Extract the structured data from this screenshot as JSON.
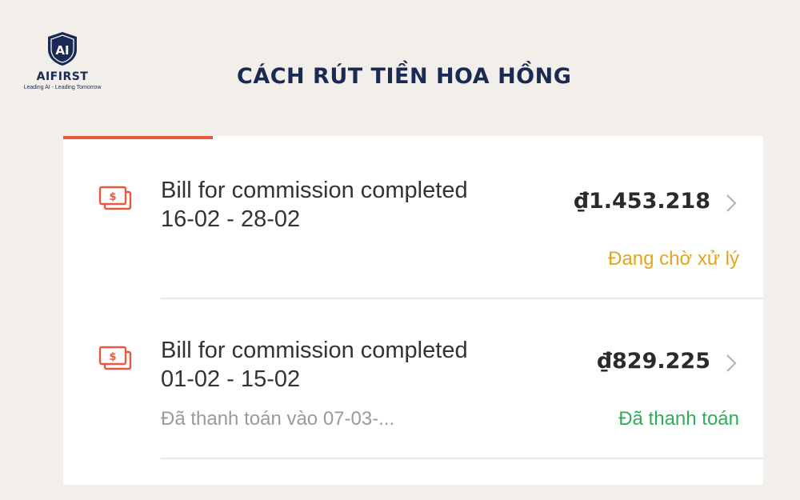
{
  "brand": {
    "name": "AIFIRST",
    "mark": "AI",
    "tagline": "Leading AI - Leading Tomorrow"
  },
  "page": {
    "title": "CÁCH RÚT TIỀN HOA HỒNG"
  },
  "colors": {
    "background": "#f2efea",
    "brand_navy": "#1b2a55",
    "accent_orange": "#e9573d",
    "status_pending": "#e3a51c",
    "status_paid": "#2eae5a"
  },
  "bills": [
    {
      "icon": "money-bill-icon",
      "title": "Bill for commission completed",
      "period": "16-02 - 28-02",
      "amount": "₫1.453.218",
      "note": "",
      "status": "Đang chờ xử lý",
      "status_color": "#e3a51c"
    },
    {
      "icon": "money-bill-icon",
      "title": "Bill for commission completed",
      "period": "01-02 - 15-02",
      "amount": "₫829.225",
      "note": "Đã thanh toán vào 07-03-...",
      "status": "Đã thanh toán",
      "status_color": "#2eae5a"
    }
  ]
}
